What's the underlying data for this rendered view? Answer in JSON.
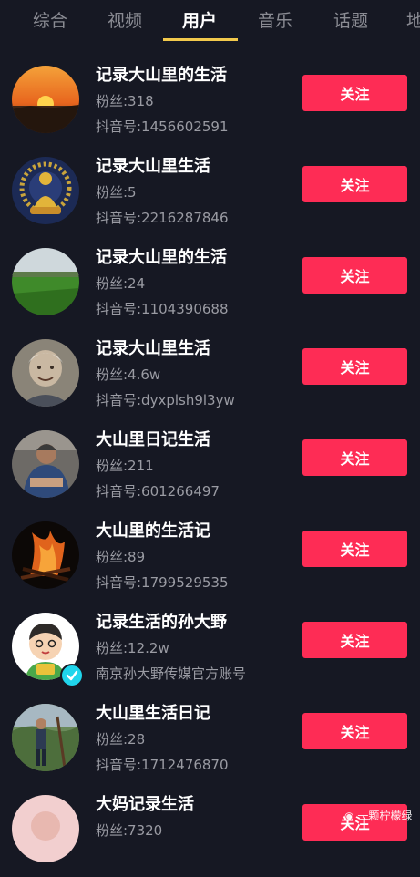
{
  "tabs": [
    {
      "label": "综合"
    },
    {
      "label": "视频"
    },
    {
      "label": "用户"
    },
    {
      "label": "音乐"
    },
    {
      "label": "话题"
    },
    {
      "label": "地"
    }
  ],
  "active_tab": "用户",
  "colors": {
    "background": "#161823",
    "follow_button": "#fe2c55",
    "tab_indicator": "#f2c94c",
    "verified_badge": "#20d5ec"
  },
  "users": [
    {
      "name": "记录大山里的生活",
      "fans": "粉丝:318",
      "uid": "抖音号:1456602591",
      "follow": "关注",
      "avatar": "sunset-avatar"
    },
    {
      "name": "记录大山里生活",
      "fans": "粉丝:5",
      "uid": "抖音号:2216287846",
      "follow": "关注",
      "avatar": "buddha-avatar"
    },
    {
      "name": "记录大山里的生活",
      "fans": "粉丝:24",
      "uid": "抖音号:1104390688",
      "follow": "关注",
      "avatar": "field-avatar"
    },
    {
      "name": "记录大山里生活",
      "fans": "粉丝:4.6w",
      "uid": "抖音号:dyxplsh9l3yw",
      "follow": "关注",
      "avatar": "elder-avatar"
    },
    {
      "name": "大山里日记生活",
      "fans": "粉丝:211",
      "uid": "抖音号:601266497",
      "follow": "关注",
      "avatar": "man-avatar"
    },
    {
      "name": "大山里的生活记",
      "fans": "粉丝:89",
      "uid": "抖音号:1799529535",
      "follow": "关注",
      "avatar": "fire-avatar"
    },
    {
      "name": "记录生活的孙大野",
      "fans": "粉丝:12.2w",
      "uid": "南京孙大野传媒官方账号",
      "follow": "关注",
      "avatar": "cartoon-avatar"
    },
    {
      "name": "大山里生活日记",
      "fans": "粉丝:28",
      "uid": "抖音号:1712476870",
      "follow": "关注",
      "avatar": "hiker-avatar"
    },
    {
      "name": "大妈记录生活",
      "fans": "粉丝:7320",
      "uid": "",
      "follow": "关注",
      "avatar": "pink-avatar"
    }
  ],
  "watermark": "一颗柠檬绿"
}
